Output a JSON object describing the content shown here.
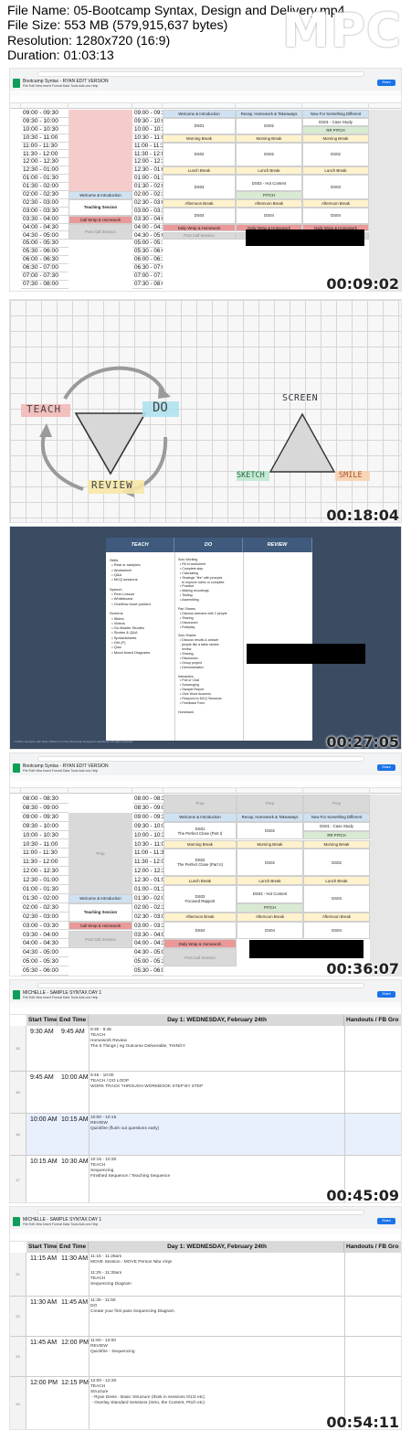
{
  "info": {
    "file_name": "File Name: 05-Bootcamp Syntax, Design and Delivery.mp4",
    "file_size": "File Size: 553 MB (579,915,637 bytes)",
    "resolution": "Resolution: 1280x720 (16:9)",
    "duration": "Duration: 01:03:13"
  },
  "logo": "MPC",
  "frames": [
    {
      "timestamp": "00:09:02"
    },
    {
      "timestamp": "00:18:04"
    },
    {
      "timestamp": "00:27:05"
    },
    {
      "timestamp": "00:36:07"
    },
    {
      "timestamp": "00:45:09"
    },
    {
      "timestamp": "00:54:11"
    }
  ],
  "sheet1": {
    "title": "Bootcamp Syntax - RYAN EDIT VERSION",
    "menu": "File  Edit  View  Insert  Format  Data  Tools  Add-ons  Help",
    "share": "Share",
    "times_left": [
      "09:00 - 09:30",
      "09:30 - 10:00",
      "10:00 - 10:30",
      "10:30 - 11:00",
      "11:00 - 11:30",
      "11:30 - 12:00",
      "12:00 - 12:30",
      "12:30 - 01:00",
      "01:00 - 01:30",
      "01:30 - 02:00",
      "02:00 - 02:30",
      "02:30 - 03:00",
      "03:00 - 03:30",
      "03:30 - 04:00",
      "04:00 - 04:30",
      "04:30 - 05:00",
      "05:00 - 05:30",
      "05:30 - 06:00",
      "06:00 - 06:30",
      "06:30 - 07:00",
      "07:00 - 07:30",
      "07:30 - 08:00"
    ],
    "times_mid": [
      "09:00 - 09:30",
      "09:30 - 10:00",
      "10:00 - 10:30",
      "10:30 - 11:00",
      "11:00 - 11:30",
      "11:30 - 12:00",
      "12:00 - 12:30",
      "12:30 - 01:00",
      "01:00 - 01:30",
      "01:30 - 02:00",
      "02:00 - 02:30",
      "02:30 - 03:00",
      "03:00 - 03:30",
      "03:30 - 04:00",
      "04:00 - 04:30",
      "04:30 - 05:00",
      "05:00 - 05:30",
      "05:30 - 06:00",
      "06:00 - 06:30",
      "06:30 - 07:00",
      "07:00 - 07:30",
      "07:30 - 08:00"
    ],
    "left_cells": {
      "welcome": "Welcome & Introduction",
      "teaching": "Teaching Session",
      "callwrap": "Call Wrap & Homework",
      "post": "Post Call Session"
    },
    "days": [
      "Welcome & Introduction",
      "Recap, Homework & Takeaways",
      "Now For Something Different"
    ],
    "ds01": "DS01 - Case Study",
    "rr_pitch": "RR PITCH",
    "morning_break": "Morning Break",
    "lunch_break": "Lunch Break",
    "afternoon_break": "Afternoon Break",
    "hot_content": "DS03 - Hot Content",
    "pitch": "PITCH",
    "daily_wrap": "Daily Wrap & Homework",
    "post_call": "Post Call Session",
    "blocks": [
      "DS01",
      "DS02",
      "DS03",
      "DS04",
      "DS02",
      "DS02",
      "DS03",
      "DS04",
      "DS04"
    ]
  },
  "whiteboard": {
    "teach": "TEACH",
    "do": "DO",
    "review": "REVIEW",
    "screen": "SCREEN",
    "sketch": "SKETCH",
    "smile": "SMILE"
  },
  "slide": {
    "headers": [
      "TEACH",
      "DO",
      "REVIEW"
    ],
    "teach_col": "Skills\n  • Real or samples\n  • Worksheet\n  • Q&A\n  • MCQ sessions\n\nSpeech\n  • Peer Lesson\n  • Whiteboard\n  • Overflow short pointed\n\nScreens\n  • Slides\n  • Videos\n  • Go Master Studies\n  • Stories & Q&A\n  • Spreadsheets\n  • Get (F)\n  • Quiz\n  • Mood board Diagrams",
    "do_col": "Solo Working\n  • Fill in worksheet\n  • Complete step\n  • Calculating\n  • Strategic \"fire\" with prompts\n    to improve rubric or complete\n  • Practice\n  • Making recordings\n  • Testing\n  • Assembling\n\nPair Shares\n  • Discuss scenario with 2 people\n  • Sharing\n  • Discussion\n  • Roleplay\n\nSolo Shares\n  • Discuss results & answer\n    people like a table stories\n    review\n  • Sharing\n  • Discussion\n  • Group project\n  • Demonstration\n\nInteraction\n  • Poll or Chat\n  • Scavenging\n  • Sample Report\n  • Give Word Answers\n  • Respond to MCQ Sessions\n  • Feedback Form\n\nHomework",
    "footer": "© 2021 Lisa Ryan with Ryan Williams 5 of the Bootcamp Designer's Handbook. All rights reserved."
  },
  "sheet4": {
    "title": "Bootcamp Syntax - RYAN EDIT VERSION",
    "times_left": [
      "08:00 - 08:30",
      "08:30 - 09:00",
      "09:00 - 09:30",
      "09:30 - 10:00",
      "10:00 - 10:30",
      "10:30 - 11:00",
      "11:00 - 11:30",
      "11:30 - 12:00",
      "12:00 - 12:30",
      "12:30 - 01:00",
      "01:00 - 01:30",
      "01:30 - 02:00",
      "02:00 - 02:30",
      "02:30 - 03:00",
      "03:00 - 03:30",
      "03:30 - 04:00",
      "04:00 - 04:30",
      "04:30 - 05:00",
      "05:00 - 05:30",
      "05:30 - 06:00"
    ],
    "times_mid": [
      "08:00 - 08:30",
      "08:30 - 09:00",
      "09:00 - 09:30",
      "09:30 - 10:00",
      "10:00 - 10:30",
      "10:30 - 11:00",
      "11:00 - 11:30",
      "11:30 - 12:00",
      "12:00 - 12:30",
      "12:30 - 01:00",
      "01:00 - 01:30",
      "01:30 - 02:00",
      "02:00 - 02:30",
      "02:30 - 03:00",
      "03:00 - 03:30",
      "03:30 - 04:00",
      "04:00 - 04:30",
      "04:30 - 05:00",
      "05:00 - 05:30",
      "05:30 - 06:00"
    ],
    "prep": "Prep",
    "ds01_perfect": "DS01\nThe Perfect Close (Part I)",
    "ds02_perfect": "DS02\nThe Perfect Close (Part II)",
    "ds03_focused": "DS03\nFocused Rapport",
    "ds04": "DS04"
  },
  "sheet5": {
    "title": "MICHELLE - SAMPLE SYNTAX DAY 1",
    "col_start": "Start Time",
    "col_end": "End Time",
    "col_day": "Day 1: WEDNESDAY, February 24th",
    "col_handouts": "Handouts / FB Gro",
    "rows": [
      {
        "num": "15",
        "start": "9:30 AM",
        "end": "9:45 AM",
        "body": "9:30 - 9:45\nTEACH\nHomework Review\nThe 5 Things | eg Outcome Deliverable, THINGY"
      },
      {
        "num": "16",
        "start": "9:45 AM",
        "end": "10:00 AM",
        "body": "9:45 - 10:00\nTEACH / DO LOOP\nWORK TRACK THROUGH WORKBOOK STEP BY STEP"
      },
      {
        "num": "16",
        "start": "10:00 AM",
        "end": "10:15 AM",
        "body": "10:00 - 10:15\nREVIEW\nQuickfire (flush out questions early)"
      },
      {
        "num": "17",
        "start": "10:15 AM",
        "end": "10:30 AM",
        "body": "10:15 - 10:30\nTEACH\nSequencing\nFinished Sequence / Teaching Sequence"
      }
    ]
  },
  "sheet6": {
    "title": "MICHELLE - SAMPLE SYNTAX DAY 1",
    "rows": [
      {
        "num": "21",
        "start": "11:15 AM",
        "end": "11:30 AM",
        "body": "11:15 - 11:25am\nMOVE Session - MOVE Person Nita Vinje\n\n11:25 - 11:30am\nTEACH\nSequencing Diagram"
      },
      {
        "num": "22",
        "start": "11:30 AM",
        "end": "11:45 AM",
        "body": "11:35 - 11:50\nDO\nCreate your first pass Sequencing Diagram"
      },
      {
        "num": "23",
        "start": "11:45 AM",
        "end": "12:00 PM",
        "body": "11:50 - 12:00\nREVIEW\nQuickfire - Sequencing"
      },
      {
        "num": "24",
        "start": "12:00 PM",
        "end": "12:15 PM",
        "body": "12:00 - 12:30\nTEACH\nStructure\n - Ryan Deiss - Basic Structure (think in sessions 0/1/2 etc)\n - Overlay Standard Sessions (Intro, the Content, Pitch etc)"
      }
    ]
  }
}
